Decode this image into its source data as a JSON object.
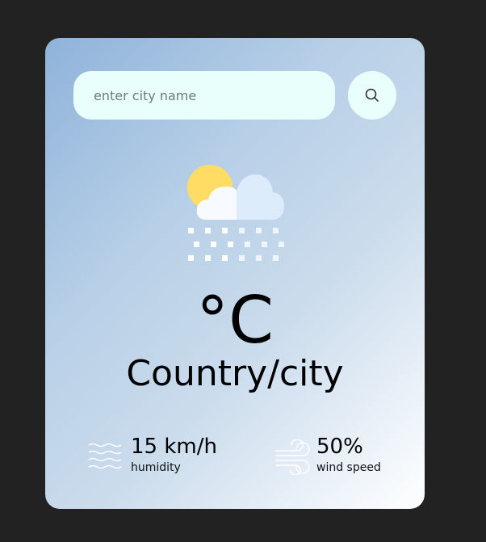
{
  "search": {
    "placeholder": "enter city name",
    "button_icon": "search-icon"
  },
  "weather": {
    "icon": "snow-cloud-sun-icon",
    "temperature": "°C",
    "location": "Country/city"
  },
  "stats": {
    "left": {
      "icon": "waves-icon",
      "value": "15 km/h",
      "label": "humidity"
    },
    "right": {
      "icon": "wind-icon",
      "value": "50%",
      "label": "wind speed"
    }
  },
  "colors": {
    "page_background": "#222222",
    "input_background": "#e8fffb",
    "sun": "#ffdc63",
    "cloud": "#f7fbff",
    "cloud_shade": "#dcecfb"
  }
}
